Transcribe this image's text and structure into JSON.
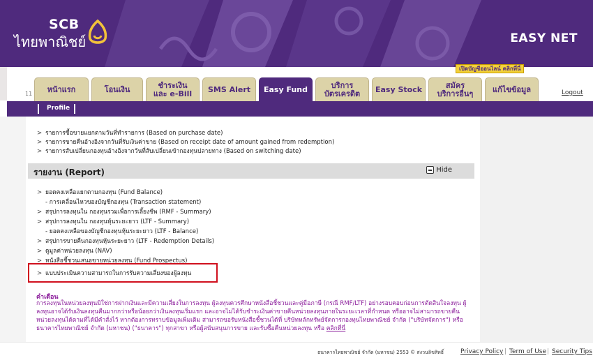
{
  "header": {
    "logo_en": "SCB",
    "logo_th": "ไทยพาณิชย์",
    "product": "EASY NET"
  },
  "tabs": [
    {
      "label": "หน้าแรก",
      "active": false
    },
    {
      "label": "โอนเงิน",
      "active": false
    },
    {
      "label": "ชำระเงิน\nและ e-Bill",
      "active": false
    },
    {
      "label": "SMS Alert",
      "active": false
    },
    {
      "label": "Easy Fund",
      "active": true
    },
    {
      "label": "บริการ\nบัตรเครดิต",
      "active": false
    },
    {
      "label": "Easy Stock",
      "active": false
    },
    {
      "label": "สมัคร\nบริการอื่นๆ",
      "active": false
    },
    {
      "label": "แก้ไขข้อมูล",
      "active": false
    }
  ],
  "tab_left_mark": "11",
  "promo_badge": "เปิดบัญชีออนไลน์ คลิกที่นี่",
  "logout": "Logout",
  "subnav": {
    "profile": "Profile"
  },
  "top_links": [
    "รายการซื้อขายแยกตามวันที่ทำรายการ (Based on purchase date)",
    "รายการขายคืนอ้างอิงจากวันที่รับเงินค่าขาย (Based on receipt date of amount gained from redemption)",
    "รายการสับเปลี่ยนกองทุนอ้างอิงจากวันที่สับเปลี่ยนเข้ากองทุนปลายทาง (Based on switching date)"
  ],
  "report": {
    "title": "รายงาน (Report)",
    "hide_label": "Hide",
    "items": [
      {
        "text": "ยอดคงเหลือแยกตามกองทุน (Fund Balance)",
        "sub": false
      },
      {
        "text": "- การเคลื่อนไหวของบัญชีกองทุน (Transaction statement)",
        "sub": true
      },
      {
        "text": "สรุปการลงทุนใน กองทุนรวมเพื่อการเลี้ยงชีพ (RMF - Summary)",
        "sub": false
      },
      {
        "text": "สรุปการลงทุนใน กองทุนหุ้นระยะยาว (LTF - Summary)",
        "sub": false
      },
      {
        "text": "- ยอดคงเหลือของบัญชีกองทุนหุ้นระยะยาว (LTF - Balance)",
        "sub": true
      },
      {
        "text": "สรุปการขายคืนกองทุนหุ้นระยะยาว (LTF - Redemption Details)",
        "sub": false
      },
      {
        "text": "ดูมูลค่าหน่วยลงทุน (NAV)",
        "sub": false
      },
      {
        "text": "หนังสือชี้ชวนเสนอขายหน่วยลงทุน (Fund Prospectus)",
        "sub": false
      },
      {
        "text": "แบบประเมินความสามารถในการรับความเสี่ยงของผู้ลงทุน",
        "sub": false
      }
    ]
  },
  "warning": {
    "title": "คำเตือน",
    "text": "การลงทุนในหน่วยลงทุนมิใช่การฝากเงินและมีความเสี่ยงในการลงทุน ผู้ลงทุนควรศึกษาหนังสือชี้ชวนและคู่มือภาษี (กรณี RMF/LTF) อย่างรอบคอบก่อนการตัดสินใจลงทุน ผู้ลงทุนอาจได้รับเงินลงทุนคืนมากกว่าหรือน้อยกว่าเงินลงทุนเริ่มแรก และอาจไม่ได้รับชำระเงินค่าขายคืนหน่วยลงทุนภายในระยะเวลาที่กำหนด หรืออาจไม่สามารถขายคืนหน่วยลงทุนได้ตามที่ได้มีคำสั่งไว้ หากต้องการทราบข้อมูลเพิ่มเติม สามารถขอรับหนังสือชี้ชวนได้ที่ บริษัทหลักทรัพย์จัดการกองทุนไทยพาณิชย์ จำกัด (\"บริษัทจัดการ\") หรือธนาคารไทยพาณิชย์ จำกัด (มหาชน) (\"ธนาคาร\") ทุกสาขา หรือผู้สนับสนุนการขาย และรับซื้อคืนหน่วยลงทุน หรือ ",
    "link": "คลิกที่นี่"
  },
  "footer": {
    "copyright": "ธนาคารไทยพาณิชย์ จำกัด (มหาชน) 2553 © สงวนลิขสิทธิ์",
    "links": [
      "Privacy Policy",
      "Term of Use",
      "Security Tips"
    ]
  },
  "colors": {
    "brand_purple": "#4f2a7d",
    "tab_gold": "#dcd3a8",
    "warning_text": "#8a1b9a",
    "highlight_red": "#d0101e"
  }
}
